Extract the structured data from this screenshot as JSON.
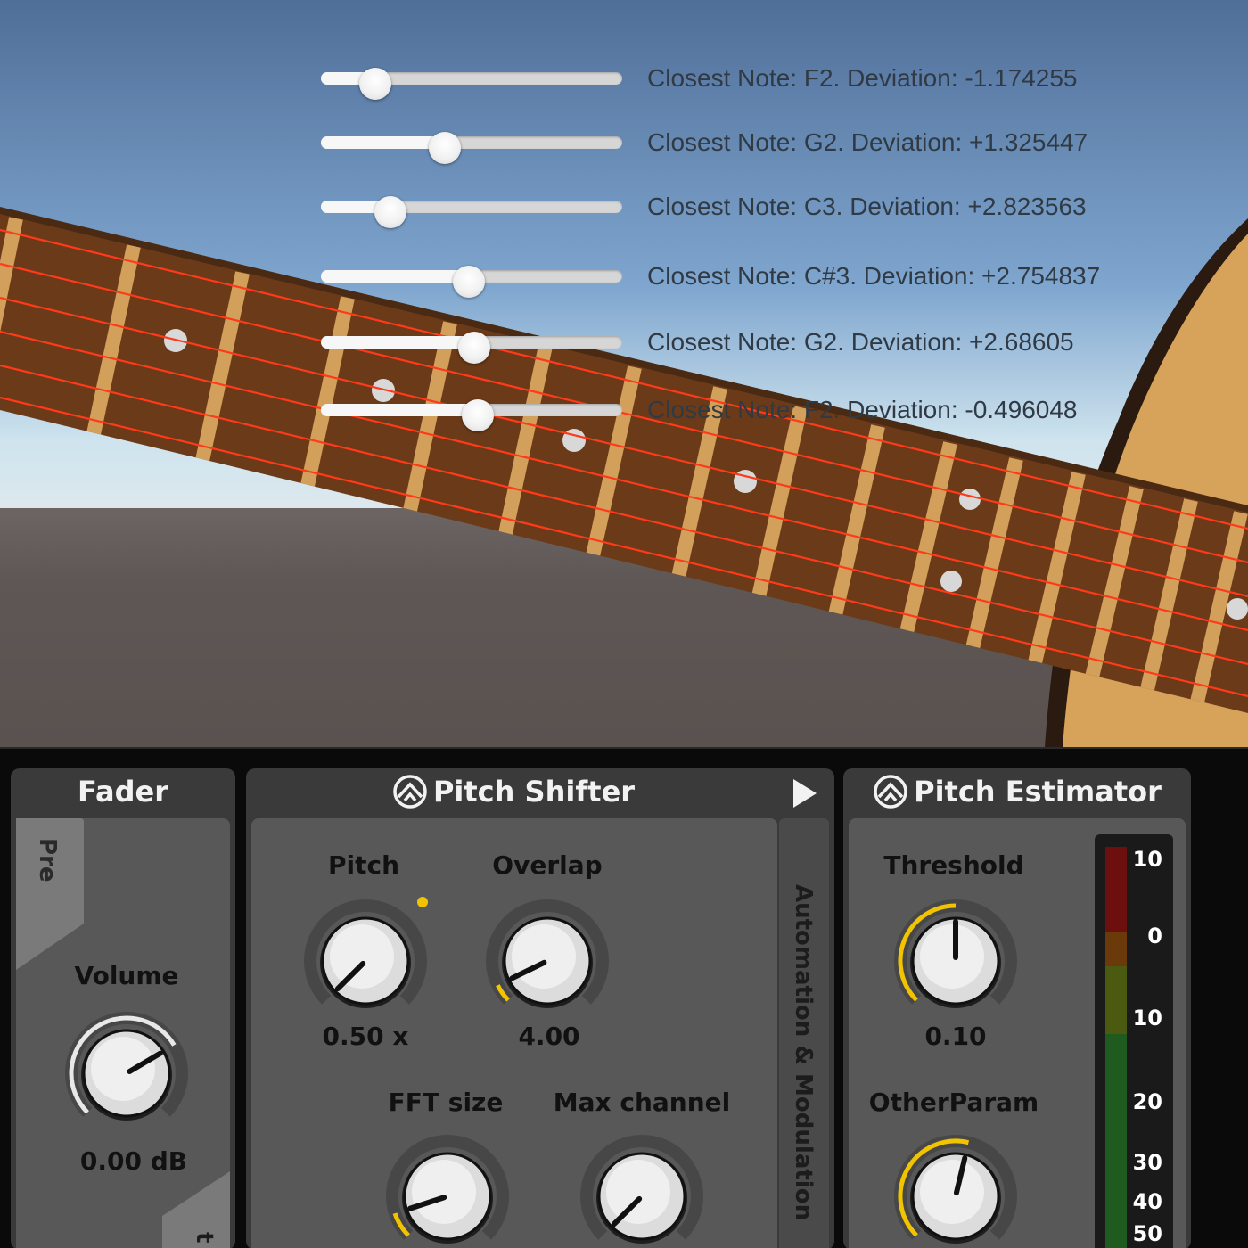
{
  "sliders": [
    {
      "value": 0.18,
      "label": "Closest Note: F2. Deviation: -1.174255"
    },
    {
      "value": 0.41,
      "label": "Closest Note: G2. Deviation: +1.325447"
    },
    {
      "value": 0.23,
      "label": "Closest Note: C3. Deviation: +2.823563"
    },
    {
      "value": 0.49,
      "label": "Closest Note: C#3. Deviation: +2.754837"
    },
    {
      "value": 0.51,
      "label": "Closest Note: G2. Deviation: +2.68605"
    },
    {
      "value": 0.52,
      "label": "Closest Note: F2. Deviation: -0.496048"
    }
  ],
  "colors": {
    "sky_top": "#4f6e98",
    "sky_bottom": "#cfe4ee",
    "ground": "#5c5552",
    "fretboard": "#6b3a18",
    "fret": "#d2a05a",
    "string": "#ff3a1a",
    "inlay": "#d8d8d8",
    "guitar_body": "#d7a35a",
    "accent_yellow": "#f2c400"
  },
  "fader": {
    "title": "Fader",
    "tab_pre": "Pre",
    "tab_post_partial": "t",
    "volume_label": "Volume",
    "volume_value": "0.00 dB",
    "volume_level": 0.72
  },
  "pitch_shifter": {
    "title": "Pitch Shifter",
    "side_tab": "Automation & Modulation",
    "params": [
      {
        "key": "pitch",
        "label": "Pitch",
        "value": "0.50 x",
        "level": 0.0
      },
      {
        "key": "overlap",
        "label": "Overlap",
        "value": "4.00",
        "level": 0.07
      },
      {
        "key": "fft",
        "label": "FFT size",
        "value": "",
        "level": 0.1
      },
      {
        "key": "maxch",
        "label": "Max channel",
        "value": "",
        "level": 0.0
      }
    ]
  },
  "pitch_estimator": {
    "title": "Pitch Estimator",
    "params": [
      {
        "key": "threshold",
        "label": "Threshold",
        "value": "0.10",
        "level": 0.5
      },
      {
        "key": "other",
        "label": "OtherParam",
        "value": "",
        "level": 0.55
      }
    ],
    "meter_labels": [
      "10",
      "0",
      "10",
      "20",
      "30",
      "40",
      "50"
    ]
  }
}
